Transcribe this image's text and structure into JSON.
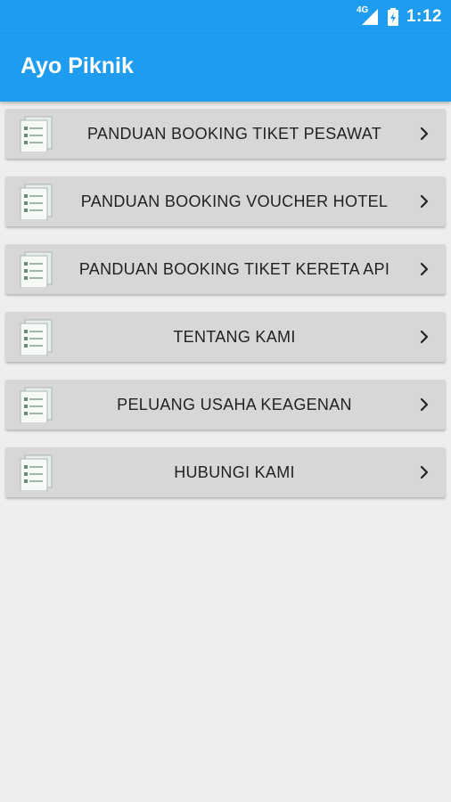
{
  "status_bar": {
    "network": "4G",
    "time": "1:12",
    "icons": [
      "signal-icon",
      "battery-charging-icon"
    ]
  },
  "app_bar": {
    "title": "Ayo Piknik"
  },
  "menu": {
    "items": [
      {
        "label": "PANDUAN BOOKING TIKET PESAWAT"
      },
      {
        "label": "PANDUAN BOOKING VOUCHER HOTEL"
      },
      {
        "label": "PANDUAN BOOKING TIKET KERETA API"
      },
      {
        "label": "TENTANG KAMI"
      },
      {
        "label": "PELUANG USAHA KEAGENAN"
      },
      {
        "label": "HUBUNGI KAMI"
      }
    ],
    "item_icon": "document-list-icon",
    "trailing_icon": "chevron-right-icon"
  },
  "colors": {
    "primary": "#1e9cf0",
    "background": "#eeeeee",
    "item_background": "#d7d7d7",
    "text": "#222222"
  }
}
